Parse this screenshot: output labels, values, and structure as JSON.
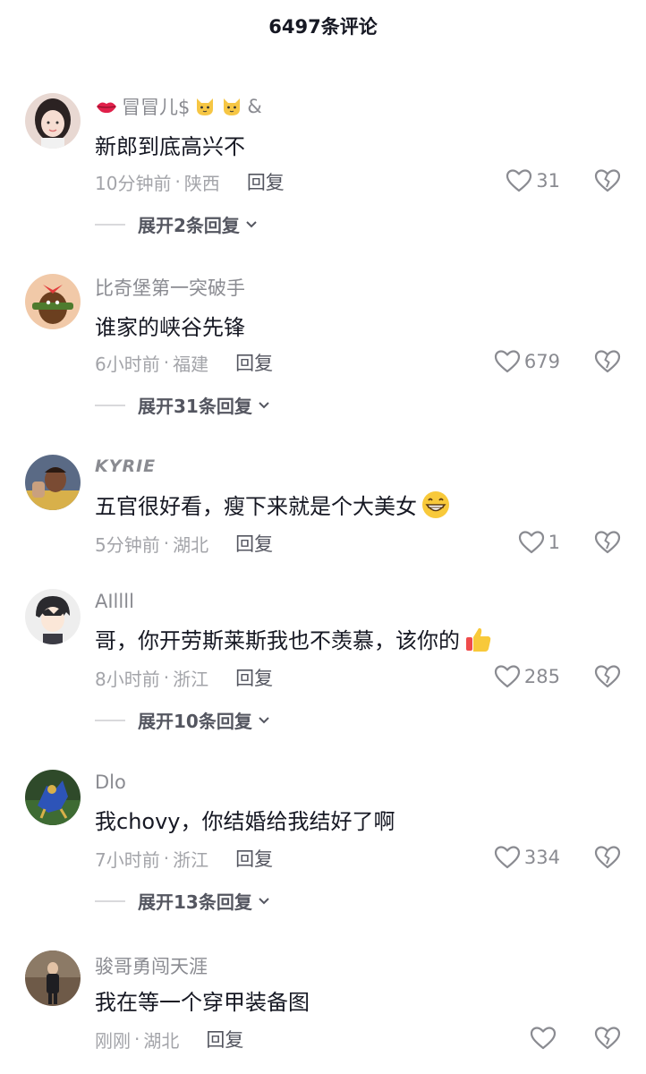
{
  "header": {
    "title": "6497条评论"
  },
  "comments": [
    {
      "username": "冒冒儿$",
      "username_suffix": "&",
      "text": "新郎到底高兴不",
      "time": "10分钟前",
      "location": "陕西",
      "reply_label": "回复",
      "likes": "31",
      "expand": "展开2条回复"
    },
    {
      "username": "比奇堡第一突破手",
      "text": "谁家的峡谷先锋",
      "time": "6小时前",
      "location": "福建",
      "reply_label": "回复",
      "likes": "679",
      "expand": "展开31条回复"
    },
    {
      "username": "KYRIE",
      "text": "五官很好看，瘦下来就是个大美女",
      "time": "5分钟前",
      "location": "湖北",
      "reply_label": "回复",
      "likes": "1"
    },
    {
      "username": "AIllll",
      "text": "哥，你开劳斯莱斯我也不羡慕，该你的",
      "time": "8小时前",
      "location": "浙江",
      "reply_label": "回复",
      "likes": "285",
      "expand": "展开10条回复"
    },
    {
      "username": "Dlo",
      "text": "我chovy，你结婚给我结好了啊",
      "time": "7小时前",
      "location": "浙江",
      "reply_label": "回复",
      "likes": "334",
      "expand": "展开13条回复"
    },
    {
      "username": "骏哥勇闯天涯",
      "text": "我在等一个穿甲装备图",
      "time": "刚刚",
      "location": "湖北",
      "reply_label": "回复",
      "likes": ""
    }
  ],
  "meta_separator": "·",
  "colors": {
    "text": "#161823",
    "secondary": "#8a8b91",
    "meta": "#a3a4a9"
  }
}
